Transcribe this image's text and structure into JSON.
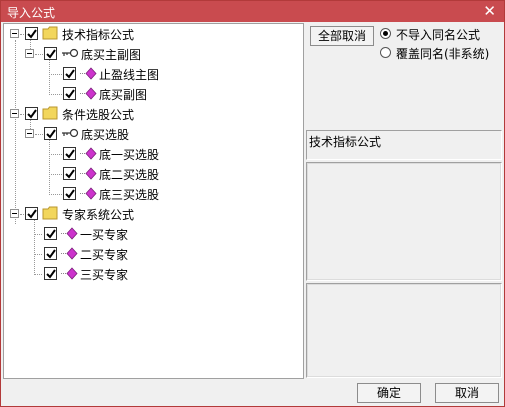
{
  "window": {
    "title": "导入公式",
    "close_glyph": "✕"
  },
  "tree": {
    "nodes": [
      {
        "label": "技术指标公式",
        "type": "folder"
      },
      {
        "label": "底买主副图",
        "type": "key"
      },
      {
        "label": "止盈线主图",
        "type": "gem"
      },
      {
        "label": "底买副图",
        "type": "gem"
      },
      {
        "label": "条件选股公式",
        "type": "folder"
      },
      {
        "label": "底买选股",
        "type": "key"
      },
      {
        "label": "底一买选股",
        "type": "gem"
      },
      {
        "label": "底二买选股",
        "type": "gem"
      },
      {
        "label": "底三买选股",
        "type": "gem"
      },
      {
        "label": "专家系统公式",
        "type": "folder"
      },
      {
        "label": "一买专家",
        "type": "gem"
      },
      {
        "label": "二买专家",
        "type": "gem"
      },
      {
        "label": "三买专家",
        "type": "gem"
      }
    ]
  },
  "options": {
    "cancel_all_label": "全部取消",
    "radio_no_import": "不导入同名公式",
    "radio_overwrite": "覆盖同名(非系统)",
    "selected": "radio_no_import"
  },
  "info": {
    "category_label": "技术指标公式"
  },
  "footer": {
    "ok_label": "确定",
    "cancel_label": "取消"
  },
  "colors": {
    "title_bar": "#c94b4f",
    "gem": "#cc33cc",
    "folder": "#f2d65c"
  }
}
